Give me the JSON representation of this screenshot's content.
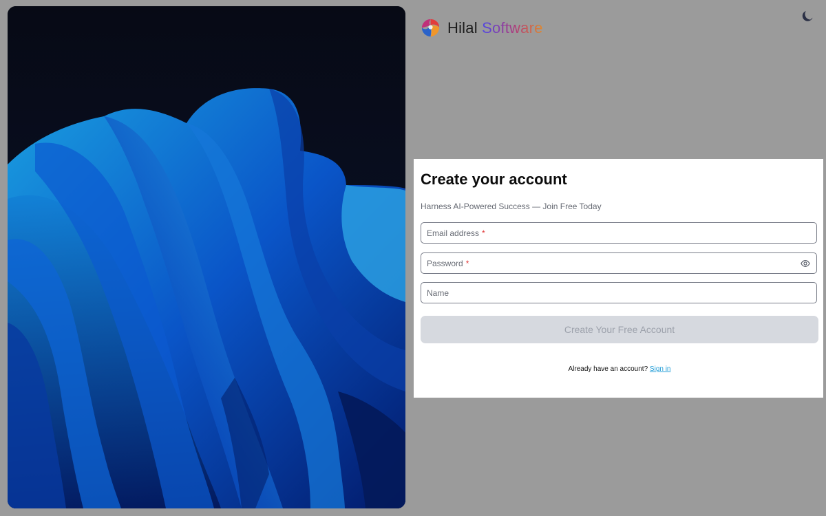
{
  "brand": {
    "name_part1": "Hilal",
    "name_part2": "Software",
    "logo_icon": "hilal-logo-icon"
  },
  "header": {
    "theme_toggle_icon": "moon-icon"
  },
  "hero": {
    "image": "abstract-blue-wave-artwork"
  },
  "form": {
    "title": "Create your account",
    "subtitle": "Harness AI-Powered Success — Join Free Today",
    "email_label": "Email address",
    "password_label": "Password",
    "name_label": "Name",
    "required_mark": "*",
    "password_toggle_icon": "eye-icon",
    "submit_label": "Create Your Free Account"
  },
  "footer": {
    "signin_prompt": "Already have an account?",
    "signin_link": "Sign in"
  },
  "colors": {
    "page_bg": "#9b9b9b",
    "card_bg": "#ffffff",
    "button_bg": "#d6d9df",
    "link": "#1d9bd6",
    "required": "#e23b3b"
  }
}
